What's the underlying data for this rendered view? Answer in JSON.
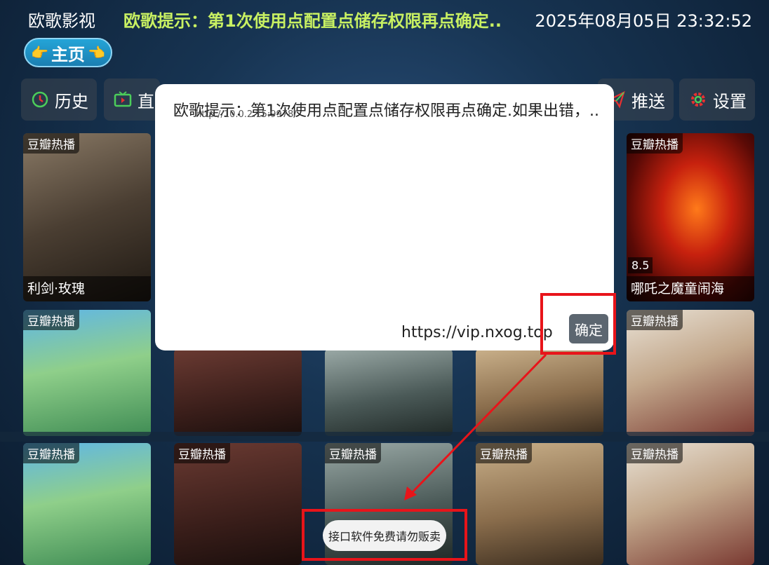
{
  "header": {
    "app_title": "欧歌影视",
    "marquee": "欧歌提示：第1次使用点配置点储存权限再点确定..",
    "datetime": "2025年08月05日 23:32:52",
    "home_label": "主页"
  },
  "nav": {
    "items": [
      {
        "label": "历史",
        "icon": "history-icon"
      },
      {
        "label": "直",
        "icon": "tv-icon"
      },
      {
        "label": "推送",
        "icon": "send-icon"
      },
      {
        "label": "设置",
        "icon": "gear-icon"
      }
    ]
  },
  "dialog": {
    "message": "欧歌提示：第1次使用点配置点储存权限再点确定.如果出错，..",
    "url": "http://10.0.2.15:9978/",
    "site": "https://vip.nxog.top",
    "ok_label": "确定"
  },
  "cards": {
    "row1": [
      {
        "tag": "豆瓣热播",
        "title": "利剑·玫瑰"
      },
      {
        "tag": "豆瓣热播",
        "rating": "8.5",
        "title": "哪吒之魔童闹海"
      }
    ],
    "row2": [
      {
        "tag": "豆瓣热播"
      },
      {
        "tag": "豆瓣热播"
      }
    ],
    "row3": [
      {
        "tag": "豆瓣热播"
      },
      {
        "tag": "豆瓣热播"
      },
      {
        "tag": "豆瓣热播"
      },
      {
        "tag": "豆瓣热播"
      },
      {
        "tag": "豆瓣热播"
      }
    ]
  },
  "toast": "接口软件免费请勿贩卖",
  "colors": {
    "marquee": "#c8f062",
    "highlight": "#e8141a",
    "home_button": "#1b8fc6"
  }
}
